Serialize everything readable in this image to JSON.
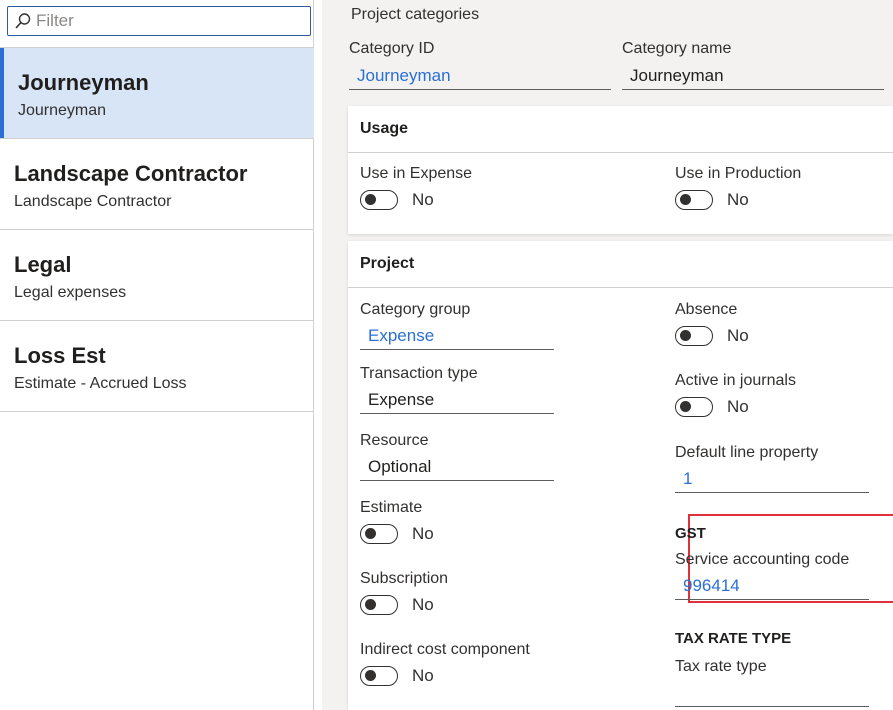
{
  "filter": {
    "placeholder": "Filter"
  },
  "list": [
    {
      "title": "Journeyman",
      "subtitle": "Journeyman",
      "selected": true
    },
    {
      "title": "Landscape Contractor",
      "subtitle": "Landscape Contractor",
      "selected": false
    },
    {
      "title": "Legal",
      "subtitle": "Legal expenses",
      "selected": false
    },
    {
      "title": "Loss Est",
      "subtitle": "Estimate - Accrued Loss",
      "selected": false
    }
  ],
  "page": {
    "title": "Project categories"
  },
  "header": {
    "category_id_label": "Category ID",
    "category_id_value": "Journeyman",
    "category_name_label": "Category name",
    "category_name_value": "Journeyman"
  },
  "usage": {
    "title": "Usage",
    "use_in_expense_label": "Use in Expense",
    "use_in_expense_value": "No",
    "use_in_production_label": "Use in Production",
    "use_in_production_value": "No"
  },
  "project": {
    "title": "Project",
    "category_group_label": "Category group",
    "category_group_value": "Expense",
    "transaction_type_label": "Transaction type",
    "transaction_type_value": "Expense",
    "resource_label": "Resource",
    "resource_value": "Optional",
    "estimate_label": "Estimate",
    "estimate_value": "No",
    "subscription_label": "Subscription",
    "subscription_value": "No",
    "indirect_cost_label": "Indirect cost component",
    "indirect_cost_value": "No",
    "absence_label": "Absence",
    "absence_value": "No",
    "active_in_journals_label": "Active in journals",
    "active_in_journals_value": "No",
    "default_line_property_label": "Default line property",
    "default_line_property_value": "1",
    "gst_caption": "GST",
    "service_accounting_code_label": "Service accounting code",
    "service_accounting_code_value": "996414",
    "tax_rate_type_caption": "TAX RATE TYPE",
    "tax_rate_type_label": "Tax rate type",
    "tax_rate_type_value": ""
  },
  "colors": {
    "accent": "#2b6fd6",
    "selected_bg": "#d7e5f6",
    "highlight_border": "#e0303a"
  },
  "icons": {
    "filter": "search-icon"
  }
}
